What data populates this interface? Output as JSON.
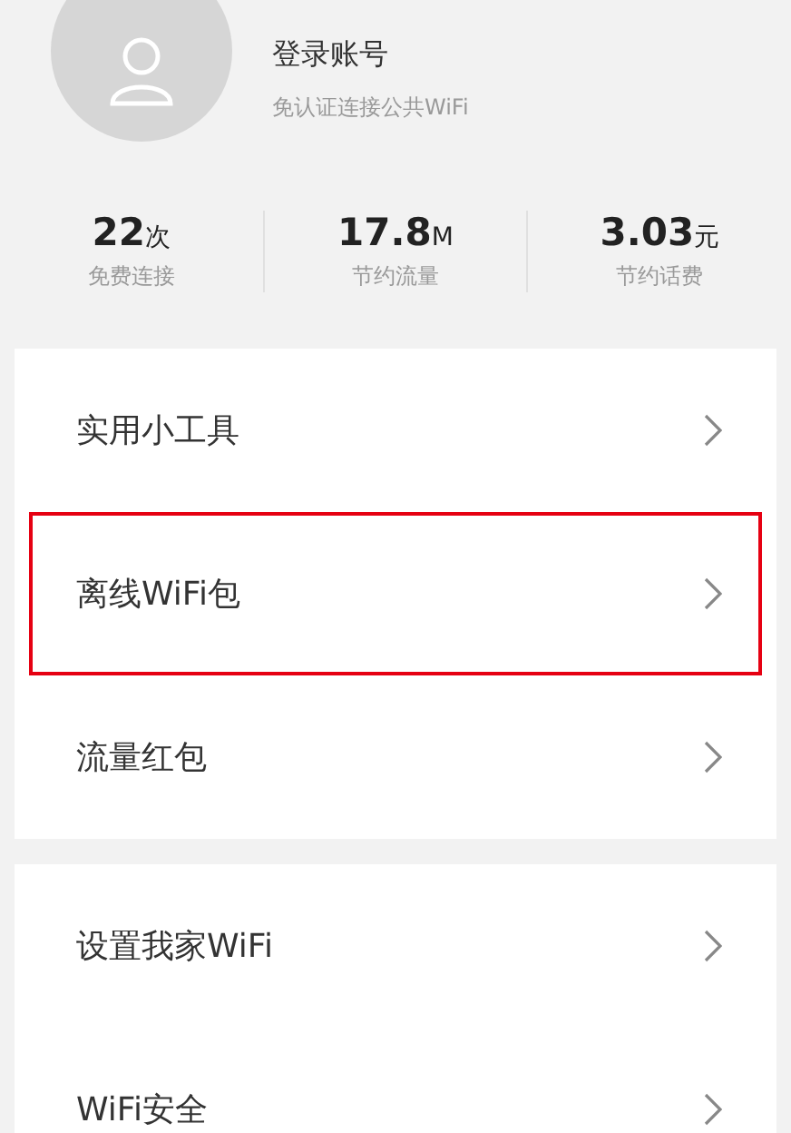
{
  "profile": {
    "title": "登录账号",
    "subtitle": "免认证连接公共WiFi"
  },
  "stats": [
    {
      "value": "22",
      "unit": "次",
      "label": "免费连接"
    },
    {
      "value": "17.8",
      "unit": "M",
      "label": "节约流量"
    },
    {
      "value": "3.03",
      "unit": "元",
      "label": "节约话费"
    }
  ],
  "groups": [
    {
      "items": [
        {
          "label": "实用小工具",
          "highlighted": false
        },
        {
          "label": "离线WiFi包",
          "highlighted": true
        },
        {
          "label": "流量红包",
          "highlighted": false
        }
      ]
    },
    {
      "items": [
        {
          "label": "设置我家WiFi",
          "highlighted": false
        },
        {
          "label": "WiFi安全",
          "highlighted": false
        }
      ]
    }
  ]
}
